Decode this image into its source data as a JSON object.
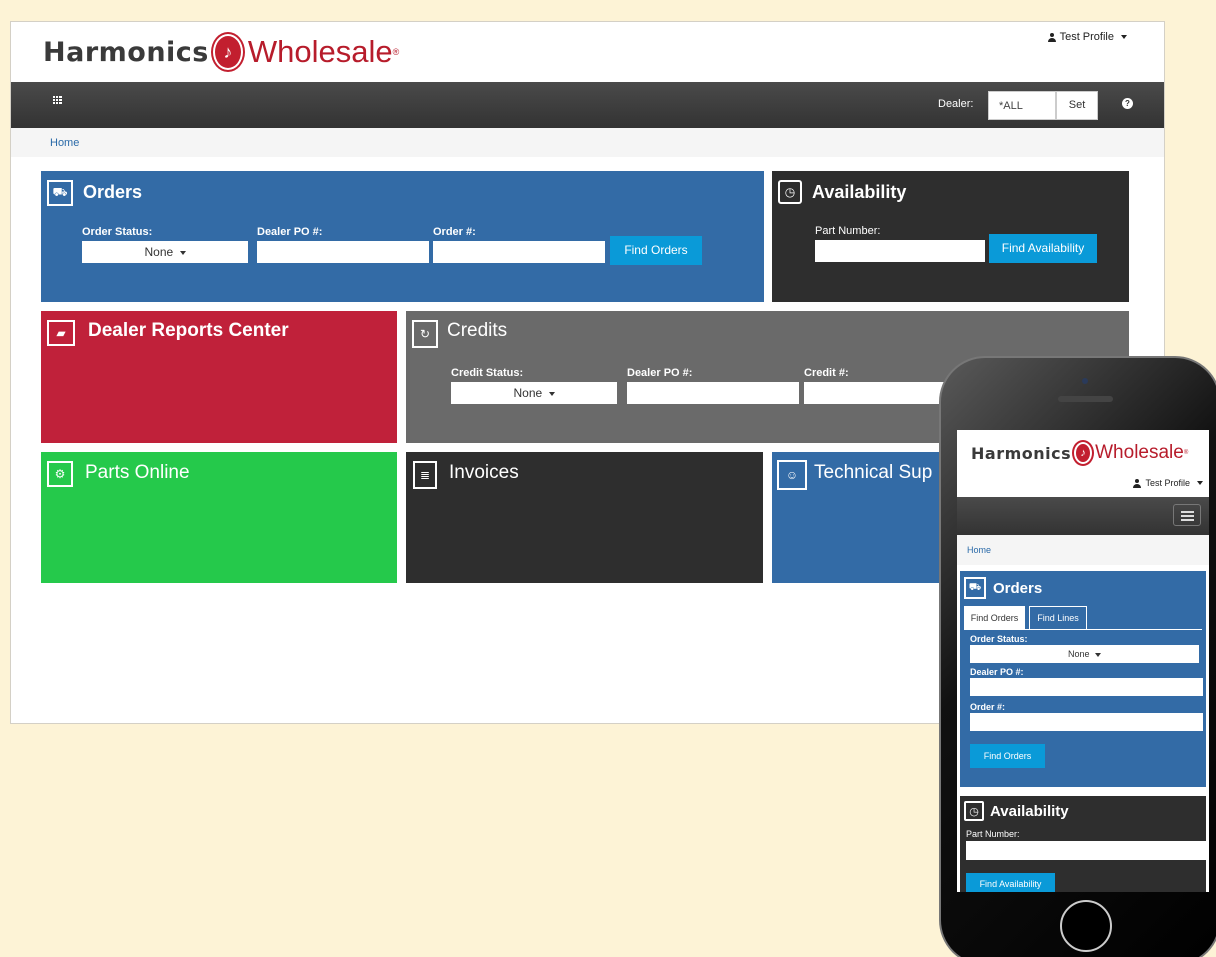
{
  "brand": {
    "name_left": "Harmonics",
    "name_right": "Wholesale",
    "registered": "®"
  },
  "profile": {
    "label": "Test Profile"
  },
  "nav": {
    "dealer_label": "Dealer:",
    "dealer_value": "*ALL",
    "set_label": "Set",
    "help_symbol": "?"
  },
  "breadcrumb": {
    "home": "Home"
  },
  "orders": {
    "title": "Orders",
    "status_label": "Order Status:",
    "status_value": "None",
    "dealer_po_label": "Dealer PO #:",
    "order_num_label": "Order #:",
    "find_button": "Find Orders"
  },
  "availability": {
    "title": "Availability",
    "part_label": "Part Number:",
    "find_button": "Find Availability"
  },
  "reports": {
    "title": "Dealer Reports Center"
  },
  "credits": {
    "title": "Credits",
    "status_label": "Credit Status:",
    "status_value": "None",
    "dealer_po_label": "Dealer PO #:",
    "credit_num_label": "Credit #:"
  },
  "parts": {
    "title": "Parts Online"
  },
  "invoices": {
    "title": "Invoices"
  },
  "support": {
    "title": "Technical Sup"
  },
  "mobile": {
    "tabs": [
      "Find Orders",
      "Find Lines"
    ],
    "orders_title": "Orders",
    "status_label": "Order Status:",
    "status_value": "None",
    "dealer_po_label": "Dealer PO #:",
    "order_num_label": "Order #:",
    "find_orders": "Find Orders",
    "availability_title": "Availability",
    "part_label": "Part Number:",
    "find_availability": "Find Availability"
  },
  "colors": {
    "blue_tile": "#336ba6",
    "dark_tile": "#2e2e2e",
    "red_tile": "#c0213a",
    "grey_tile": "#6a6a6a",
    "green_tile": "#25c94b",
    "action_button": "#0a9ad8",
    "brand_red": "#b71c2b",
    "background": "#fdf3d6"
  },
  "icons": {
    "orders": "truck-icon",
    "availability": "clock-icon",
    "reports": "folder-open-icon",
    "credits": "refresh-icon",
    "parts": "gears-icon",
    "invoices": "document-icon",
    "support": "support-agent-icon",
    "nav_apps": "grid-icon",
    "nav_help": "question-circle-icon",
    "profile": "user-icon",
    "mobile_menu": "hamburger-icon"
  }
}
